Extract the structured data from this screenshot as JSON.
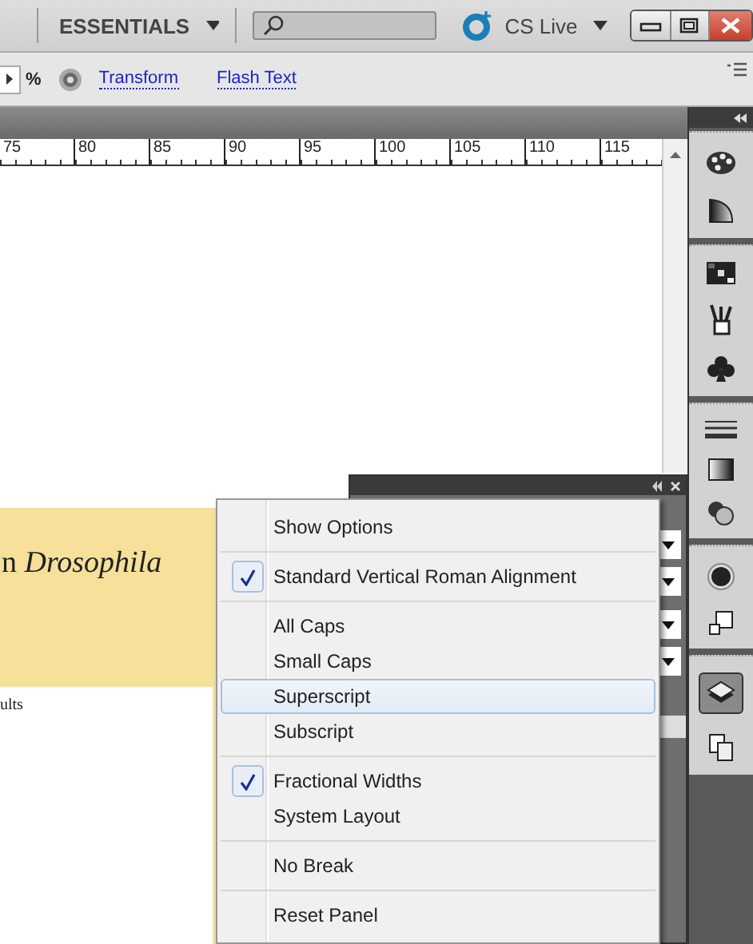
{
  "app_bar": {
    "workspace": "ESSENTIALS",
    "cs_live": "CS Live"
  },
  "control_bar": {
    "unit": "%",
    "links": [
      "Transform",
      "Flash Text"
    ]
  },
  "ruler": {
    "labels": [
      "75",
      "80",
      "85",
      "90",
      "95",
      "100",
      "105",
      "110",
      "115"
    ]
  },
  "document": {
    "heading": "n *Drosophila*",
    "body": "ults"
  },
  "menu": {
    "groups": [
      [
        {
          "label": "Show Options",
          "checked": false,
          "selected": false
        }
      ],
      [
        {
          "label": "Standard Vertical Roman Alignment",
          "checked": true,
          "selected": false
        }
      ],
      [
        {
          "label": "All Caps",
          "checked": false,
          "selected": false
        },
        {
          "label": "Small Caps",
          "checked": false,
          "selected": false
        },
        {
          "label": "Superscript",
          "checked": false,
          "selected": true
        },
        {
          "label": "Subscript",
          "checked": false,
          "selected": false
        }
      ],
      [
        {
          "label": "Fractional Widths",
          "checked": true,
          "selected": false
        },
        {
          "label": "System Layout",
          "checked": false,
          "selected": false
        }
      ],
      [
        {
          "label": "No Break",
          "checked": false,
          "selected": false
        }
      ],
      [
        {
          "label": "Reset Panel",
          "checked": false,
          "selected": false
        }
      ]
    ]
  }
}
